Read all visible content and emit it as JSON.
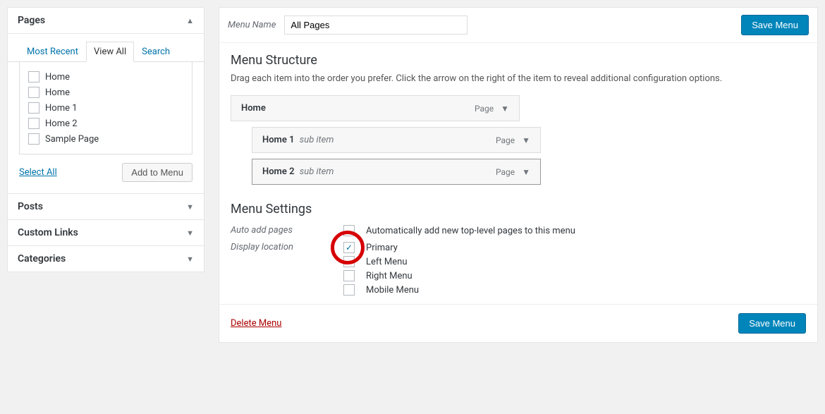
{
  "sidebar": {
    "pages": {
      "title": "Pages",
      "tabs": {
        "recent": "Most Recent",
        "viewall": "View All",
        "search": "Search"
      },
      "items": [
        {
          "label": "Home"
        },
        {
          "label": "Home"
        },
        {
          "label": "Home 1"
        },
        {
          "label": "Home 2"
        },
        {
          "label": "Sample Page"
        }
      ],
      "select_all": "Select All",
      "add_btn": "Add to Menu"
    },
    "posts_title": "Posts",
    "custom_links_title": "Custom Links",
    "categories_title": "Categories"
  },
  "menu": {
    "name_label": "Menu Name",
    "name_value": "All Pages",
    "save_btn": "Save Menu",
    "structure_title": "Menu Structure",
    "structure_help": "Drag each item into the order you prefer. Click the arrow on the right of the item to reveal additional configuration options.",
    "type_label": "Page",
    "sub_item_label": "sub item",
    "items": [
      {
        "title": "Home",
        "depth": 0
      },
      {
        "title": "Home 1",
        "depth": 1
      },
      {
        "title": "Home 2",
        "depth": 1,
        "selected": true
      }
    ],
    "settings_title": "Menu Settings",
    "auto_add_label": "Auto add pages",
    "auto_add_opt": "Automatically add new top-level pages to this menu",
    "display_loc_label": "Display location",
    "locations": [
      {
        "label": "Primary",
        "checked": true
      },
      {
        "label": "Left Menu",
        "checked": false
      },
      {
        "label": "Right Menu",
        "checked": false
      },
      {
        "label": "Mobile Menu",
        "checked": false
      }
    ],
    "delete_label": "Delete Menu"
  }
}
